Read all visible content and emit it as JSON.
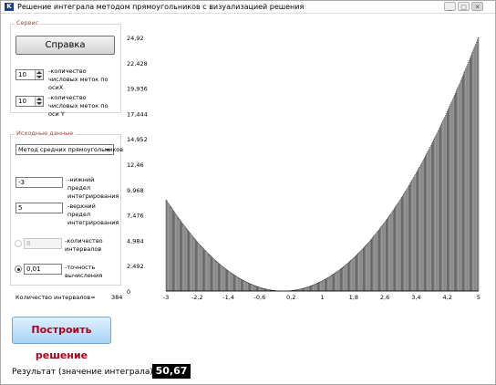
{
  "window": {
    "title": "Решение интеграла методом прямоугольников с визуализацией решения",
    "app_icon": "K",
    "min": "_",
    "max": "□",
    "close": "✕"
  },
  "service": {
    "legend": "Сервис",
    "help_button": "Справка",
    "x_marks_value": "10",
    "x_marks_label": "-количество числовых меток по осиX",
    "y_marks_value": "10",
    "y_marks_label": "-количество числовых меток по оси Y"
  },
  "input": {
    "legend": "Исходные данные",
    "method": "Метод средних прямоугольников",
    "lower_value": "-3",
    "lower_label": "-нижний предел интегрирования",
    "upper_value": "5",
    "upper_label": "-верхний предел интегрирования",
    "intervals_value": "8",
    "intervals_label": "-количество интервалов",
    "accuracy_value": "0,01",
    "accuracy_label": "-точность вычисления"
  },
  "count": {
    "label": "Количество интервалов=",
    "value": "384"
  },
  "build_button": "Построить решение",
  "result": {
    "label": "Результат (значение интеграла)=",
    "value": "50,67"
  },
  "chart_data": {
    "type": "bar",
    "title": "",
    "xlabel": "",
    "ylabel": "",
    "function": "f(x) = x^2",
    "x_range": [
      -3,
      5
    ],
    "bar_count": 384,
    "rule": "midpoint",
    "xlim": [
      -3,
      5
    ],
    "ylim": [
      0,
      24.92
    ],
    "x_ticks": [
      "-3",
      "-2,2",
      "-1,4",
      "-0,6",
      "0,2",
      "1",
      "1,8",
      "2,6",
      "3,4",
      "4,2",
      "5"
    ],
    "y_ticks": [
      "0",
      "2,492",
      "4,984",
      "7,476",
      "9,968",
      "12,46",
      "14,952",
      "17,444",
      "19,936",
      "22,428",
      "24,92"
    ],
    "bar_color": "#000000"
  }
}
